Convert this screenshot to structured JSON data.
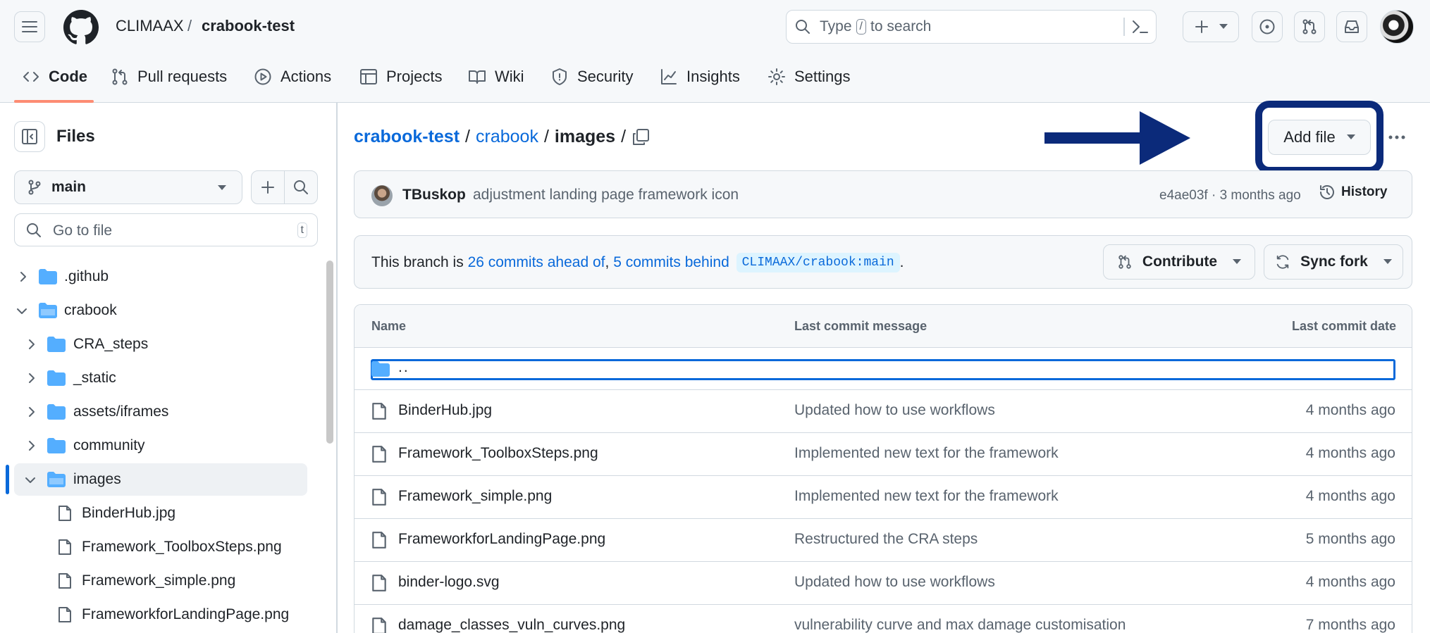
{
  "header": {
    "owner": "CLIMAAX",
    "separator": "/",
    "repo": "crabook-test",
    "search_prefix": "Type",
    "search_key": "/",
    "search_suffix": "to search"
  },
  "nav_tabs": [
    {
      "label": "Code"
    },
    {
      "label": "Pull requests"
    },
    {
      "label": "Actions"
    },
    {
      "label": "Projects"
    },
    {
      "label": "Wiki"
    },
    {
      "label": "Security"
    },
    {
      "label": "Insights"
    },
    {
      "label": "Settings"
    }
  ],
  "sidebar": {
    "title": "Files",
    "branch": "main",
    "goto_placeholder": "Go to file",
    "goto_shortcut": "t",
    "tree": [
      {
        "label": ".github",
        "type": "folder",
        "expanded": false
      },
      {
        "label": "crabook",
        "type": "folder",
        "expanded": true
      },
      {
        "label": "CRA_steps",
        "type": "folder",
        "expanded": false
      },
      {
        "label": "_static",
        "type": "folder",
        "expanded": false
      },
      {
        "label": "assets/iframes",
        "type": "folder",
        "expanded": false
      },
      {
        "label": "community",
        "type": "folder",
        "expanded": false
      },
      {
        "label": "images",
        "type": "folder",
        "expanded": true,
        "selected": true
      },
      {
        "label": "BinderHub.jpg",
        "type": "file"
      },
      {
        "label": "Framework_ToolboxSteps.png",
        "type": "file"
      },
      {
        "label": "Framework_simple.png",
        "type": "file"
      },
      {
        "label": "FrameworkforLandingPage.png",
        "type": "file"
      }
    ]
  },
  "path": {
    "root": "crabook-test",
    "sep": "/",
    "folder": "crabook",
    "current": "images",
    "trailing": "/"
  },
  "actions": {
    "add_file": "Add file"
  },
  "latest_commit": {
    "author": "TBuskop",
    "message": "adjustment landing page framework icon",
    "meta": "e4ae03f · 3 months ago",
    "history": "History"
  },
  "branch_status": {
    "prefix": "This branch is",
    "ahead": "26 commits ahead of",
    "comma": ",",
    "behind": "5 commits behind",
    "upstream": "CLIMAAX/crabook:main",
    "period": ".",
    "contribute": "Contribute",
    "sync": "Sync fork"
  },
  "table": {
    "col_name": "Name",
    "col_message": "Last commit message",
    "col_date": "Last commit date",
    "parent": "..",
    "rows": [
      {
        "name": "BinderHub.jpg",
        "message": "Updated how to use workflows",
        "date": "4 months ago"
      },
      {
        "name": "Framework_ToolboxSteps.png",
        "message": "Implemented new text for the framework",
        "date": "4 months ago"
      },
      {
        "name": "Framework_simple.png",
        "message": "Implemented new text for the framework",
        "date": "4 months ago"
      },
      {
        "name": "FrameworkforLandingPage.png",
        "message": "Restructured the CRA steps",
        "date": "5 months ago"
      },
      {
        "name": "binder-logo.svg",
        "message": "Updated how to use workflows",
        "date": "4 months ago"
      },
      {
        "name": "damage_classes_vuln_curves.png",
        "message": "vulnerability curve and max damage customisation",
        "date": "7 months ago"
      }
    ]
  },
  "colors": {
    "annotation_blue": "#0b2a7a",
    "link": "#0969da",
    "folder": "#54aeff",
    "selected_bar": "#0969da",
    "active_tab_underline": "#fd8c73"
  }
}
